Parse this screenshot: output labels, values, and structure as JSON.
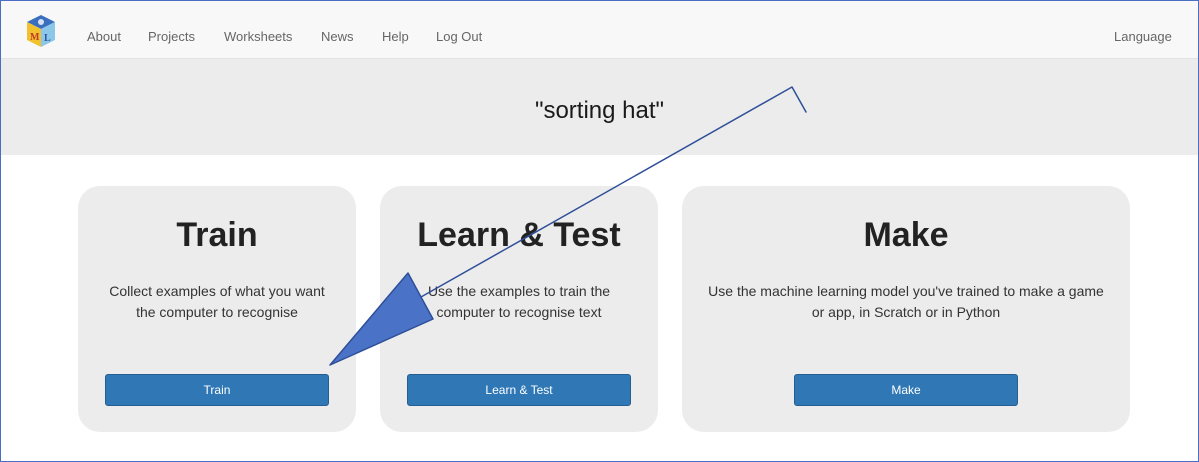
{
  "nav": {
    "items": [
      {
        "label": "About"
      },
      {
        "label": "Projects"
      },
      {
        "label": "Worksheets"
      },
      {
        "label": "News"
      },
      {
        "label": "Help"
      },
      {
        "label": "Log Out"
      }
    ],
    "language": "Language",
    "logo_letters": "ML"
  },
  "hero": {
    "title": "\"sorting hat\""
  },
  "cards": [
    {
      "title": "Train",
      "description": "Collect examples of what you want the computer to recognise",
      "button": "Train"
    },
    {
      "title": "Learn & Test",
      "description": "Use the examples to train the computer to recognise text",
      "button": "Learn & Test"
    },
    {
      "title": "Make",
      "description": "Use the machine learning model you've trained to make a game or app, in Scratch or in Python",
      "button": "Make"
    }
  ],
  "colors": {
    "button": "#2f77b5",
    "arrow": "#4a73c7",
    "card_bg": "#ececec"
  }
}
